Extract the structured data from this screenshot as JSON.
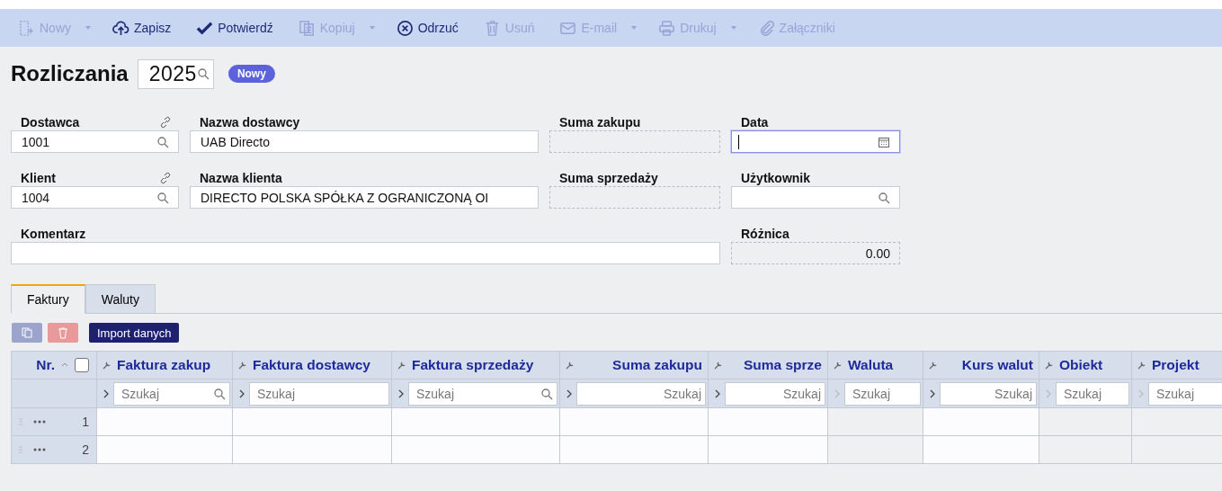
{
  "toolbar": [
    {
      "kind": "new",
      "label": "Nowy",
      "disabled": true,
      "dropdown": true
    },
    {
      "kind": "save",
      "label": "Zapisz",
      "disabled": false,
      "dropdown": false
    },
    {
      "kind": "confirm",
      "label": "Potwierdź",
      "disabled": false,
      "dropdown": false
    },
    {
      "kind": "copy",
      "label": "Kopiuj",
      "disabled": true,
      "dropdown": true
    },
    {
      "kind": "reject",
      "label": "Odrzuć",
      "disabled": false,
      "dropdown": false
    },
    {
      "kind": "delete",
      "label": "Usuń",
      "disabled": true,
      "dropdown": false
    },
    {
      "kind": "email",
      "label": "E-mail",
      "disabled": true,
      "dropdown": true
    },
    {
      "kind": "print",
      "label": "Drukuj",
      "disabled": true,
      "dropdown": true
    },
    {
      "kind": "attach",
      "label": "Załączniki",
      "disabled": true,
      "dropdown": false
    }
  ],
  "header": {
    "title": "Rozliczania",
    "year": "2025",
    "status": "Nowy"
  },
  "form": [
    {
      "kind": "lookup",
      "label": "Dostawca",
      "value": "1001",
      "link": true
    },
    {
      "kind": "text",
      "label": "Nazwa dostawcy",
      "value": "UAB Directo"
    },
    {
      "kind": "readonly",
      "label": "Suma zakupu"
    },
    {
      "kind": "date",
      "label": "Data",
      "focused": true
    },
    {
      "kind": "lookup",
      "label": "Klient",
      "value": "1004",
      "link": true
    },
    {
      "kind": "text",
      "label": "Nazwa klienta",
      "value": "DIRECTO POLSKA SPÓŁKA Z OGRANICZONĄ OI"
    },
    {
      "kind": "readonly",
      "label": "Suma sprzedaży"
    },
    {
      "kind": "lookup",
      "label": "Użytkownik"
    },
    {
      "kind": "wide",
      "label": "Komentarz"
    },
    {
      "kind": "readonly",
      "label": "Różnica",
      "value": "0.00"
    }
  ],
  "tabs": [
    {
      "label": "Faktury",
      "selected": true
    },
    {
      "label": "Waluty",
      "selected": false
    }
  ],
  "grid_toolbar": {
    "import_button": "Import danych"
  },
  "table": {
    "nr_header": "Nr.",
    "select_all": {
      "checked": false
    },
    "columns": [
      {
        "label": "Faktura zakup",
        "placeholder": "Szukaj",
        "right_aligned": false,
        "search_icon": true,
        "editable": true
      },
      {
        "label": "Faktura dostawcy",
        "placeholder": "Szukaj",
        "right_aligned": false,
        "search_icon": false,
        "editable": true
      },
      {
        "label": "Faktura sprzedaży",
        "placeholder": "Szukaj",
        "right_aligned": false,
        "search_icon": true,
        "editable": true
      },
      {
        "label": "Suma zakupu",
        "placeholder": "Szukaj",
        "right_aligned": true,
        "search_icon": false,
        "editable": true
      },
      {
        "label": "Suma sprze",
        "placeholder": "Szukaj",
        "right_aligned": true,
        "search_icon": false,
        "editable": true
      },
      {
        "label": "Waluta",
        "placeholder": "Szukaj",
        "right_aligned": false,
        "search_icon": false,
        "editable": false
      },
      {
        "label": "Kurs walut",
        "placeholder": "Szukaj",
        "right_aligned": true,
        "search_icon": false,
        "editable": true
      },
      {
        "label": "Obiekt",
        "placeholder": "Szukaj",
        "right_aligned": false,
        "search_icon": false,
        "editable": false
      },
      {
        "label": "Projekt",
        "placeholder": "Szukaj",
        "right_aligned": false,
        "search_icon": false,
        "editable": false
      }
    ],
    "rows": [
      {
        "nr": "1"
      },
      {
        "nr": "2"
      }
    ]
  }
}
